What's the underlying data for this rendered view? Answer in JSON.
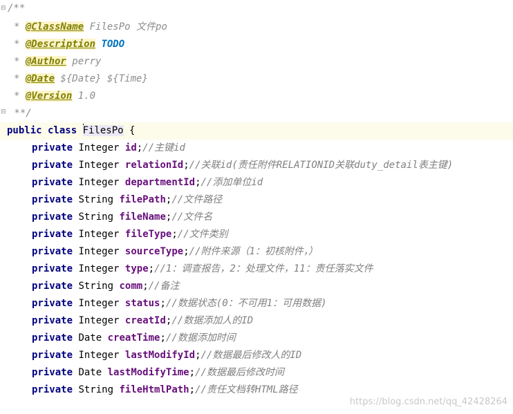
{
  "javadoc": {
    "open": "/**",
    "class_tag": "@ClassName",
    "class_value": " FilesPo 文件po",
    "desc_tag": "@Description",
    "desc_value": "TODO",
    "author_tag": "@Author",
    "author_value": " perry",
    "date_tag": "@Date",
    "date_value": " ${Date} ${Time}",
    "version_tag": "@Version",
    "version_value": " 1.0",
    "close": " **/"
  },
  "class_decl": {
    "modifiers": "public class ",
    "name": "FilesPo",
    "brace": " {"
  },
  "fields": [
    {
      "modifier": "private",
      "type": "Integer",
      "name": "id",
      "comment": "//主键id"
    },
    {
      "modifier": "private",
      "type": "Integer",
      "name": "relationId",
      "comment": "//关联id(责任附件RELATIONID关联duty_detail表主键)"
    },
    {
      "modifier": "private",
      "type": "Integer",
      "name": "departmentId",
      "comment": "//添加单位id"
    },
    {
      "modifier": "private",
      "type": "String",
      "name": "filePath",
      "comment": "//文件路径"
    },
    {
      "modifier": "private",
      "type": "String",
      "name": "fileName",
      "comment": "//文件名"
    },
    {
      "modifier": "private",
      "type": "Integer",
      "name": "fileType",
      "comment": "//文件类别"
    },
    {
      "modifier": "private",
      "type": "Integer",
      "name": "sourceType",
      "comment": "//附件来源（1：初核附件，）"
    },
    {
      "modifier": "private",
      "type": "Integer",
      "name": "type",
      "comment": "//1：调查报告，2：处理文件，11：责任落实文件"
    },
    {
      "modifier": "private",
      "type": "String",
      "name": "comm",
      "comment": "//备注"
    },
    {
      "modifier": "private",
      "type": "Integer",
      "name": "status",
      "comment": "//数据状态(0：不可用1：可用数据)"
    },
    {
      "modifier": "private",
      "type": "Integer",
      "name": "creatId",
      "comment": "//数据添加人的ID"
    },
    {
      "modifier": "private",
      "type": "Date",
      "name": "creatTime",
      "comment": "//数据添加时间"
    },
    {
      "modifier": "private",
      "type": "Integer",
      "name": "lastModifyId",
      "comment": "//数据最后修改人的ID"
    },
    {
      "modifier": "private",
      "type": "Date",
      "name": "lastModifyTime",
      "comment": "//数据最后修改时间"
    },
    {
      "modifier": "private",
      "type": "String",
      "name": "fileHtmlPath",
      "comment": "//责任文档转HTML路径"
    }
  ],
  "watermark": "https://blog.csdn.net/qq_42428264"
}
